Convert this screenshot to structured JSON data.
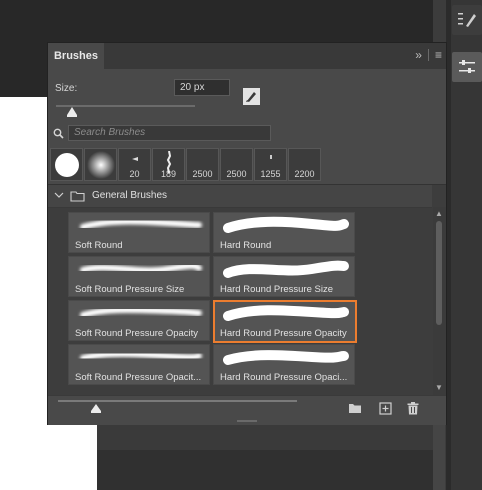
{
  "panel": {
    "tab_label": "Brushes",
    "size_label": "Size:",
    "size_value": "20 px",
    "size_slider_fraction": 0.05,
    "search_placeholder": "Search Brushes"
  },
  "presets": [
    {
      "number": "",
      "icon": "hard-round-tip-icon"
    },
    {
      "number": "",
      "icon": "soft-round-tip-icon"
    },
    {
      "number": "20",
      "icon": "small-tip-icon"
    },
    {
      "number": "189",
      "icon": "scatter-tip-icon"
    },
    {
      "number": "2500",
      "icon": "blank-tip-icon"
    },
    {
      "number": "2500",
      "icon": "blank-tip-icon"
    },
    {
      "number": "1255",
      "icon": "dot-tip-icon"
    },
    {
      "number": "2200",
      "icon": "blank-tip-icon"
    }
  ],
  "group": {
    "label": "General Brushes",
    "expanded": true
  },
  "brushes": [
    {
      "label": "Soft Round",
      "soft": true,
      "selected": false
    },
    {
      "label": "Hard Round",
      "soft": false,
      "selected": false
    },
    {
      "label": "Soft Round Pressure Size",
      "soft": true,
      "selected": false
    },
    {
      "label": "Hard Round Pressure Size",
      "soft": false,
      "selected": false
    },
    {
      "label": "Soft Round Pressure Opacity",
      "soft": true,
      "selected": false
    },
    {
      "label": "Hard Round Pressure Opacity",
      "soft": false,
      "selected": true
    },
    {
      "label": "Soft Round Pressure Opacit...",
      "soft": true,
      "selected": false
    },
    {
      "label": "Hard Round Pressure Opaci...",
      "soft": false,
      "selected": false
    }
  ],
  "bottom_bar": {
    "zoom_fraction": 0.18,
    "icons": [
      "folder-icon",
      "new-brush-icon",
      "trash-icon"
    ]
  },
  "colors": {
    "accent_selection": "#ec7d2f",
    "panel_bg": "#494949"
  }
}
